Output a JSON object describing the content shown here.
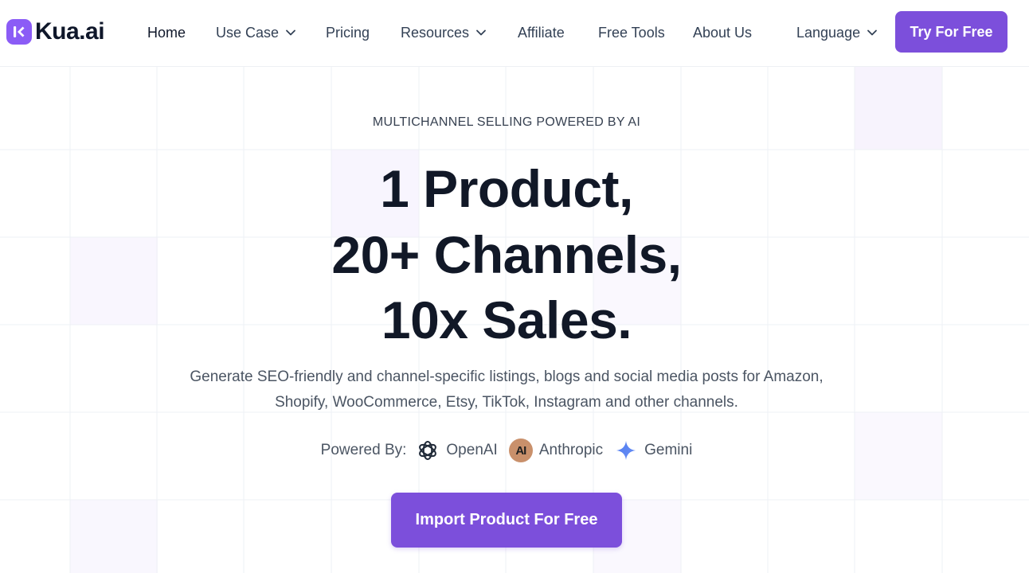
{
  "header": {
    "logo_text": "Kua.ai",
    "nav": {
      "home": "Home",
      "use_case": "Use Case",
      "pricing": "Pricing",
      "resources": "Resources",
      "affiliate": "Affiliate",
      "free_tools": "Free Tools",
      "about_us": "About Us",
      "language": "Language"
    },
    "try_button": "Try For Free"
  },
  "hero": {
    "eyebrow": "MULTICHANNEL SELLING POWERED BY AI",
    "headline_line1": "1 Product,",
    "headline_line2": "20+ Channels,",
    "headline_line3": "10x Sales.",
    "subtitle_line1": "Generate SEO-friendly and channel-specific listings, blogs and social media posts for Amazon,",
    "subtitle_line2": "Shopify, WooCommerce, Etsy, TikTok, Instagram and other channels.",
    "powered_by_label": "Powered By:",
    "providers": {
      "openai": "OpenAI",
      "anthropic": "Anthropic",
      "anthropic_badge": "AI",
      "gemini": "Gemini"
    },
    "cta_label": "Import Product For Free"
  },
  "icons": {
    "logo": "kua-logo-icon",
    "dropdown": "chevron-down-icon",
    "openai": "openai-icon",
    "anthropic": "anthropic-icon",
    "gemini": "gemini-sparkle-icon"
  },
  "colors": {
    "brand": "#7c4fdb",
    "logo_mark": "#8b5cf6",
    "text_dark": "#111827",
    "text_muted": "#4b5563",
    "anthropic_badge": "#c9906b",
    "gemini_blue": "#4f7df0"
  }
}
